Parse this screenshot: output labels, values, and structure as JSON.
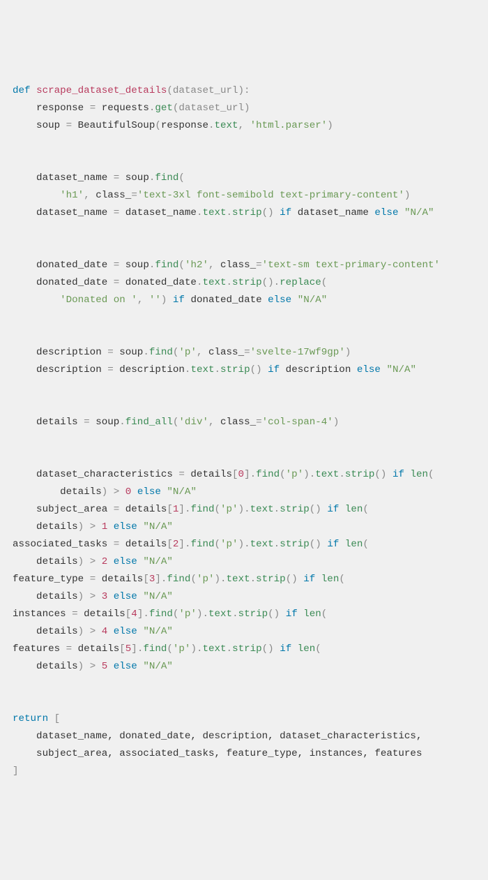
{
  "code": {
    "l1": {
      "kw": "def",
      "fn": "scrape_dataset_details",
      "p": "(dataset_url):"
    },
    "l2": {
      "a": "    response ",
      "op1": "=",
      "b": " requests",
      "op2": ".",
      "c": "get",
      "p": "(dataset_url)"
    },
    "l3": {
      "a": "    soup ",
      "op1": "=",
      "b": " BeautifulSoup",
      "p1": "(",
      "c": "response",
      "op2": ".",
      "d": "text",
      "p2": ", ",
      "s": "'html.parser'",
      "p3": ")"
    },
    "l4": "",
    "l5": "",
    "l6": {
      "a": "    dataset_name ",
      "op": "=",
      "b": " soup",
      "op2": ".",
      "c": "find",
      "p": "("
    },
    "l7": {
      "a": "        ",
      "s1": "'h1'",
      "p1": ", ",
      "b": "class_",
      "op": "=",
      "s2": "'text-3xl font-semibold text-primary-content'",
      "p2": ")"
    },
    "l8": {
      "a": "    dataset_name ",
      "op": "=",
      "b": " dataset_name",
      "op2": ".",
      "c": "text",
      "op3": ".",
      "d": "strip",
      "p": "() ",
      "kw1": "if",
      "e": " dataset_name ",
      "kw2": "else ",
      "s": "\"N/A\""
    },
    "l9": "",
    "l10": "",
    "l11": {
      "a": "    donated_date ",
      "op": "=",
      "b": " soup",
      "op2": ".",
      "c": "find",
      "p1": "(",
      "s1": "'h2'",
      "p2": ", ",
      "d": "class_",
      "op3": "=",
      "s2": "'text-sm text-primary-content'"
    },
    "l12": {
      "a": "    donated_date ",
      "op": "=",
      "b": " donated_date",
      "op2": ".",
      "c": "text",
      "op3": ".",
      "d": "strip",
      "p1": "()",
      "op4": ".",
      "e": "replace",
      "p2": "("
    },
    "l13": {
      "a": "        ",
      "s1": "'Donated on '",
      "p1": ", ",
      "s2": "''",
      "p2": ") ",
      "kw1": "if",
      "b": " donated_date ",
      "kw2": "else ",
      "s3": "\"N/A\""
    },
    "l14": "",
    "l15": "",
    "l16": {
      "a": "    description ",
      "op": "=",
      "b": " soup",
      "op2": ".",
      "c": "find",
      "p1": "(",
      "s1": "'p'",
      "p2": ", ",
      "d": "class_",
      "op3": "=",
      "s2": "'svelte-17wf9gp'",
      "p3": ")"
    },
    "l17": {
      "a": "    description ",
      "op": "=",
      "b": " description",
      "op2": ".",
      "c": "text",
      "op3": ".",
      "d": "strip",
      "p": "() ",
      "kw1": "if",
      "e": " description ",
      "kw2": "else ",
      "s": "\"N/A\""
    },
    "l18": "",
    "l19": "",
    "l20": {
      "a": "    details ",
      "op": "=",
      "b": " soup",
      "op2": ".",
      "c": "find_all",
      "p1": "(",
      "s1": "'div'",
      "p2": ", ",
      "d": "class_",
      "op3": "=",
      "s2": "'col-span-4'",
      "p3": ")"
    },
    "l21": "",
    "l22": "",
    "l23": {
      "a": "    dataset_characteristics ",
      "op": "=",
      "b": " details",
      "p1": "[",
      "n": "0",
      "p2": "]",
      "op2": ".",
      "c": "find",
      "p3": "(",
      "s": "'p'",
      "p4": ")",
      "op3": ".",
      "d": "text",
      "op4": ".",
      "e": "strip",
      "p5": "() ",
      "kw1": "if ",
      "f": "len",
      "p6": "("
    },
    "l24": {
      "a": "        details",
      "p1": ") ",
      "op": ">",
      "p2": " ",
      "n": "0",
      "b": " ",
      "kw": "else ",
      "s": "\"N/A\""
    },
    "l25": {
      "a": "    subject_area ",
      "op": "=",
      "b": " details",
      "p1": "[",
      "n": "1",
      "p2": "]",
      "op2": ".",
      "c": "find",
      "p3": "(",
      "s": "'p'",
      "p4": ")",
      "op3": ".",
      "d": "text",
      "op4": ".",
      "e": "strip",
      "p5": "() ",
      "kw1": "if ",
      "f": "len",
      "p6": "("
    },
    "l26": {
      "a": "    details",
      "p1": ") ",
      "op": ">",
      "p2": " ",
      "n": "1",
      "b": " ",
      "kw": "else ",
      "s": "\"N/A\""
    },
    "l27": {
      "a": "associated_tasks ",
      "op": "=",
      "b": " details",
      "p1": "[",
      "n": "2",
      "p2": "]",
      "op2": ".",
      "c": "find",
      "p3": "(",
      "s": "'p'",
      "p4": ")",
      "op3": ".",
      "d": "text",
      "op4": ".",
      "e": "strip",
      "p5": "() ",
      "kw1": "if ",
      "f": "len",
      "p6": "("
    },
    "l28": {
      "a": "    details",
      "p1": ") ",
      "op": ">",
      "p2": " ",
      "n": "2",
      "b": " ",
      "kw": "else ",
      "s": "\"N/A\""
    },
    "l29": {
      "a": "feature_type ",
      "op": "=",
      "b": " details",
      "p1": "[",
      "n": "3",
      "p2": "]",
      "op2": ".",
      "c": "find",
      "p3": "(",
      "s": "'p'",
      "p4": ")",
      "op3": ".",
      "d": "text",
      "op4": ".",
      "e": "strip",
      "p5": "() ",
      "kw1": "if ",
      "f": "len",
      "p6": "("
    },
    "l30": {
      "a": "    details",
      "p1": ") ",
      "op": ">",
      "p2": " ",
      "n": "3",
      "b": " ",
      "kw": "else ",
      "s": "\"N/A\""
    },
    "l31": {
      "a": "instances ",
      "op": "=",
      "b": " details",
      "p1": "[",
      "n": "4",
      "p2": "]",
      "op2": ".",
      "c": "find",
      "p3": "(",
      "s": "'p'",
      "p4": ")",
      "op3": ".",
      "d": "text",
      "op4": ".",
      "e": "strip",
      "p5": "() ",
      "kw1": "if ",
      "f": "len",
      "p6": "("
    },
    "l32": {
      "a": "    details",
      "p1": ") ",
      "op": ">",
      "p2": " ",
      "n": "4",
      "b": " ",
      "kw": "else ",
      "s": "\"N/A\""
    },
    "l33": {
      "a": "features ",
      "op": "=",
      "b": " details",
      "p1": "[",
      "n": "5",
      "p2": "]",
      "op2": ".",
      "c": "find",
      "p3": "(",
      "s": "'p'",
      "p4": ")",
      "op3": ".",
      "d": "text",
      "op4": ".",
      "e": "strip",
      "p5": "() ",
      "kw1": "if ",
      "f": "len",
      "p6": "("
    },
    "l34": {
      "a": "    details",
      "p1": ") ",
      "op": ">",
      "p2": " ",
      "n": "5",
      "b": " ",
      "kw": "else ",
      "s": "\"N/A\""
    },
    "l35": "",
    "l36": "",
    "l37": {
      "kw": "return",
      "p": " ["
    },
    "l38": "    dataset_name, donated_date, description, dataset_characteristics,",
    "l39": "    subject_area, associated_tasks, feature_type, instances, features",
    "l40": "]"
  }
}
